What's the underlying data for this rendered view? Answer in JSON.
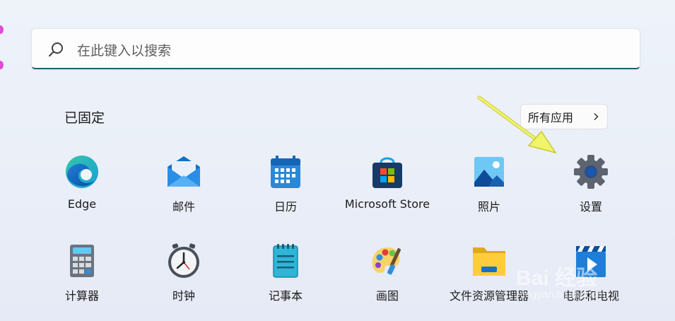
{
  "search": {
    "placeholder": "在此键入以搜索",
    "icon": "search-icon"
  },
  "pinned": {
    "title": "已固定",
    "all_apps_label": "所有应用",
    "apps_row1": [
      {
        "label": "Edge",
        "icon": "edge-icon"
      },
      {
        "label": "邮件",
        "icon": "mail-icon"
      },
      {
        "label": "日历",
        "icon": "calendar-icon"
      },
      {
        "label": "Microsoft Store",
        "icon": "store-icon"
      },
      {
        "label": "照片",
        "icon": "photos-icon"
      },
      {
        "label": "设置",
        "icon": "settings-icon"
      }
    ],
    "apps_row2": [
      {
        "label": "计算器",
        "icon": "calculator-icon"
      },
      {
        "label": "时钟",
        "icon": "clock-icon"
      },
      {
        "label": "记事本",
        "icon": "notepad-icon"
      },
      {
        "label": "画图",
        "icon": "paint-icon"
      },
      {
        "label": "文件资源管理器",
        "icon": "file-explorer-icon"
      },
      {
        "label": "电影和电视",
        "icon": "movies-tv-icon"
      }
    ]
  },
  "watermark": {
    "text": "Bai 经验",
    "sub": "jingyan.baidu.com"
  },
  "colors": {
    "search_underline": "#1c5f6e",
    "annotation_arrow": "#f0f46a"
  }
}
